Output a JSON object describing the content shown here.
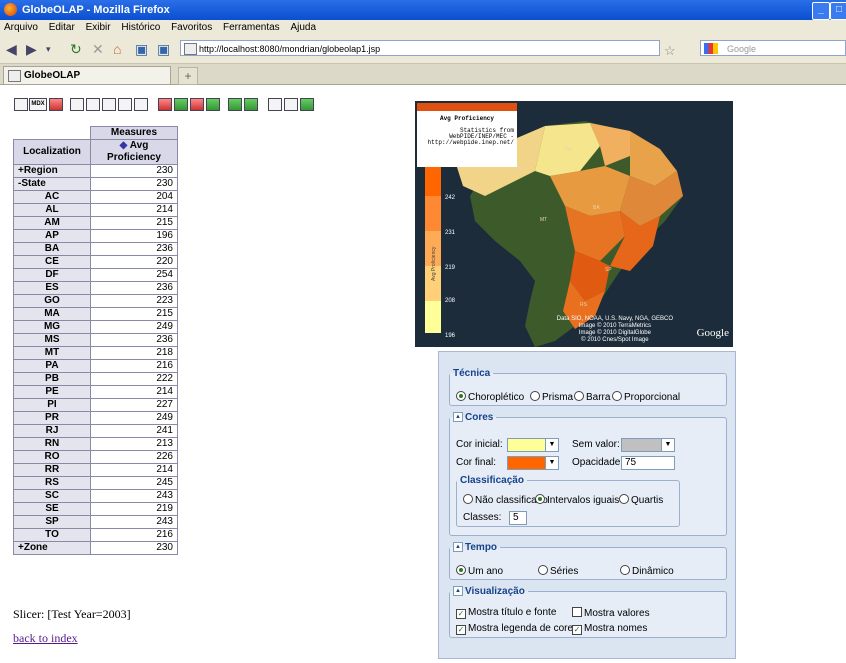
{
  "window": {
    "title": "GlobeOLAP - Mozilla Firefox"
  },
  "menu": [
    "Arquivo",
    "Editar",
    "Exibir",
    "Histórico",
    "Favoritos",
    "Ferramentas",
    "Ajuda"
  ],
  "nav": {
    "url": "http://localhost:8080/mondrian/globeolap1.jsp",
    "search_placeholder": "Google"
  },
  "tab": {
    "title": "GlobeOLAP",
    "new_tab": "+"
  },
  "pivot": {
    "measures_header": "Measures",
    "dimension_header": "Localization",
    "measure_header": "Avg Proficiency",
    "rows": [
      {
        "label": "+Region",
        "value": "230",
        "level": "top"
      },
      {
        "label": "-State",
        "value": "230",
        "level": "top"
      },
      {
        "label": "AC",
        "value": "204",
        "level": "child"
      },
      {
        "label": "AL",
        "value": "214",
        "level": "child"
      },
      {
        "label": "AM",
        "value": "215",
        "level": "child"
      },
      {
        "label": "AP",
        "value": "196",
        "level": "child"
      },
      {
        "label": "BA",
        "value": "236",
        "level": "child"
      },
      {
        "label": "CE",
        "value": "220",
        "level": "child"
      },
      {
        "label": "DF",
        "value": "254",
        "level": "child"
      },
      {
        "label": "ES",
        "value": "236",
        "level": "child"
      },
      {
        "label": "GO",
        "value": "223",
        "level": "child"
      },
      {
        "label": "MA",
        "value": "215",
        "level": "child"
      },
      {
        "label": "MG",
        "value": "249",
        "level": "child"
      },
      {
        "label": "MS",
        "value": "236",
        "level": "child"
      },
      {
        "label": "MT",
        "value": "218",
        "level": "child"
      },
      {
        "label": "PA",
        "value": "216",
        "level": "child"
      },
      {
        "label": "PB",
        "value": "222",
        "level": "child"
      },
      {
        "label": "PE",
        "value": "214",
        "level": "child"
      },
      {
        "label": "PI",
        "value": "227",
        "level": "child"
      },
      {
        "label": "PR",
        "value": "249",
        "level": "child"
      },
      {
        "label": "RJ",
        "value": "241",
        "level": "child"
      },
      {
        "label": "RN",
        "value": "213",
        "level": "child"
      },
      {
        "label": "RO",
        "value": "226",
        "level": "child"
      },
      {
        "label": "RR",
        "value": "214",
        "level": "child"
      },
      {
        "label": "RS",
        "value": "245",
        "level": "child"
      },
      {
        "label": "SC",
        "value": "243",
        "level": "child"
      },
      {
        "label": "SE",
        "value": "219",
        "level": "child"
      },
      {
        "label": "SP",
        "value": "243",
        "level": "child"
      },
      {
        "label": "TO",
        "value": "216",
        "level": "child"
      },
      {
        "label": "+Zone",
        "value": "230",
        "level": "top"
      }
    ]
  },
  "slicer": "Slicer: [Test Year=2003]",
  "back_link": "back to index",
  "map": {
    "legend_title": "Avg Proficiency",
    "legend_source": "Statistics from WebPIDE/INEP/MEC - http://webpide.inep.net/",
    "scale_label": "Avg Proficiency",
    "scale_ticks": [
      "242",
      "231",
      "219",
      "208",
      "196"
    ],
    "attribution": [
      "Data SIO, NOAA, U.S. Navy, NGA, GEBCO",
      "Image © 2010 TerraMetrics",
      "Image © 2010 DigitalGlobe",
      "© 2010 Cnes/Spot Image"
    ],
    "logo": "Google",
    "colors": {
      "low": "#ffff99",
      "high": "#ff6600"
    }
  },
  "panel": {
    "tecnica": {
      "legend": "Técnica",
      "options": [
        "Choroplético",
        "Prisma",
        "Barra",
        "Proporcional"
      ],
      "selected": "Choroplético"
    },
    "cores": {
      "legend": "Cores",
      "cor_inicial": "Cor inicial:",
      "cor_inicial_color": "#ffff99",
      "sem_valor": "Sem valor:",
      "sem_valor_color": "#c0c0c0",
      "cor_final": "Cor final:",
      "cor_final_color": "#ff6600",
      "opacidade": "Opacidade:",
      "opacidade_value": "75",
      "classificacao": {
        "legend": "Classificação",
        "options": [
          "Não classificado",
          "Intervalos iguais",
          "Quartis"
        ],
        "selected": "Intervalos iguais",
        "classes_label": "Classes:",
        "classes_value": "5"
      }
    },
    "tempo": {
      "legend": "Tempo",
      "options": [
        "Um ano",
        "Séries",
        "Dinâmico"
      ],
      "selected": "Um ano"
    },
    "visualizacao": {
      "legend": "Visualização",
      "options": [
        {
          "label": "Mostra título e fonte",
          "checked": true
        },
        {
          "label": "Mostra valores",
          "checked": false
        },
        {
          "label": "Mostra legenda de cores",
          "checked": true
        },
        {
          "label": "Mostra nomes",
          "checked": true
        }
      ]
    }
  }
}
